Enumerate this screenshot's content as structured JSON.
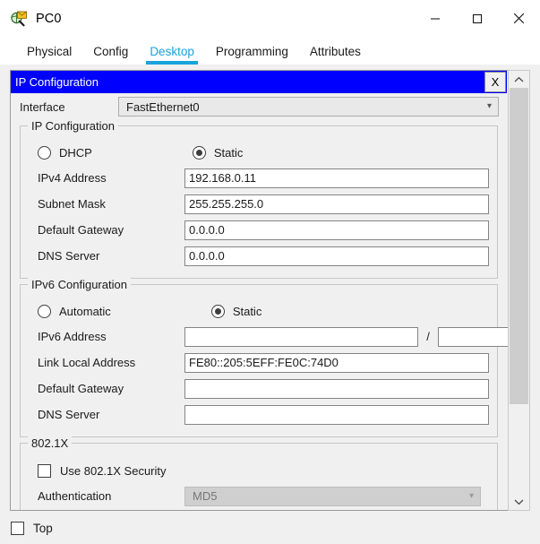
{
  "window": {
    "title": "PC0",
    "icon": "device-inspect-icon",
    "controls": [
      {
        "name": "minimize-button",
        "glyph": "minimize-icon"
      },
      {
        "name": "maximize-button",
        "glyph": "maximize-icon"
      },
      {
        "name": "close-button",
        "glyph": "close-icon"
      }
    ]
  },
  "tabs": [
    {
      "label": "Physical",
      "active": false
    },
    {
      "label": "Config",
      "active": false
    },
    {
      "label": "Desktop",
      "active": true
    },
    {
      "label": "Programming",
      "active": false
    },
    {
      "label": "Attributes",
      "active": false
    }
  ],
  "panel": {
    "caption": "IP Configuration",
    "close_label": "X",
    "interface": {
      "label": "Interface",
      "value": "FastEthernet0"
    },
    "ipv4": {
      "group_title": "IP Configuration",
      "mode_dhcp": "DHCP",
      "mode_static": "Static",
      "selected_mode": "Static",
      "fields": [
        {
          "label": "IPv4 Address",
          "value": "192.168.0.11"
        },
        {
          "label": "Subnet Mask",
          "value": "255.255.255.0"
        },
        {
          "label": "Default Gateway",
          "value": "0.0.0.0"
        },
        {
          "label": "DNS Server",
          "value": "0.0.0.0"
        }
      ]
    },
    "ipv6": {
      "group_title": "IPv6 Configuration",
      "mode_automatic": "Automatic",
      "mode_static": "Static",
      "selected_mode": "Static",
      "address_label": "IPv6 Address",
      "address_value": "",
      "prefix_separator": "/",
      "prefix_value": "",
      "fields": [
        {
          "label": "Link Local Address",
          "value": "FE80::205:5EFF:FE0C:74D0"
        },
        {
          "label": "Default Gateway",
          "value": ""
        },
        {
          "label": "DNS Server",
          "value": ""
        }
      ]
    },
    "dot1x": {
      "group_title": "802.1X",
      "use_security_label": "Use 802.1X Security",
      "use_security_checked": false,
      "authentication_label": "Authentication",
      "authentication_value": "MD5",
      "authentication_disabled": true
    }
  },
  "scrollbar": {
    "up_glyph": "chevron-up-icon",
    "down_glyph": "chevron-down-icon"
  },
  "bottom": {
    "top_label": "Top",
    "top_checked": false
  },
  "colors": {
    "accent": "#17a3dc",
    "caption_bg": "#0000ff",
    "caption_fg": "#ffffff",
    "window_bg": "#f0f0f0"
  }
}
